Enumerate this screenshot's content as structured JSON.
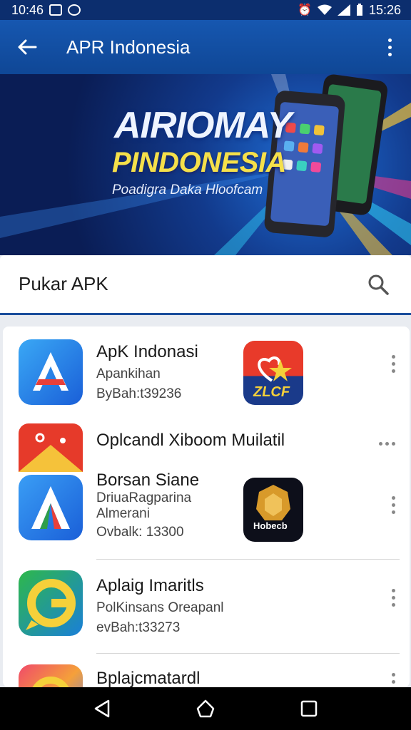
{
  "status_bar": {
    "time_left": "10:46",
    "time_right": "15:26"
  },
  "app_bar": {
    "title": "APR Indonesia",
    "back_icon": "arrow-left-icon",
    "menu_icon": "more-vert-icon"
  },
  "banner": {
    "title_line1": "AIRIOMAY",
    "title_line2": "PINDONESIA",
    "subtitle": "Poadigra Daka Hloofcam"
  },
  "search": {
    "value": "Pukar APK",
    "icon": "search-icon"
  },
  "apps": [
    {
      "title": "ApK Indonasi",
      "line1": "Apankihan",
      "line2": "ByBah:t39236"
    },
    {
      "title": "Oplcandl Xiboom Muilatil"
    },
    {
      "title": "Borsan Siane",
      "line1": "DriuaRagparina",
      "line2": "Almerani",
      "line3": "Ovbalk: 13300",
      "side_icon_text": "Hobecb"
    },
    {
      "title": "Aplaig Imaritls",
      "line1": "PolKinsans Oreapanl",
      "line2": "evBah:t33273"
    },
    {
      "title": "Bplajcmatardl"
    }
  ],
  "side_icon_1_text": "ZLCF",
  "colors": {
    "app_bar": "#1657b0",
    "status_bar": "#0c2e6e",
    "banner_yellow": "#f5e04a"
  },
  "nav_bar": {
    "back": "triangle-back-icon",
    "home": "home-icon",
    "recents": "square-recents-icon"
  }
}
